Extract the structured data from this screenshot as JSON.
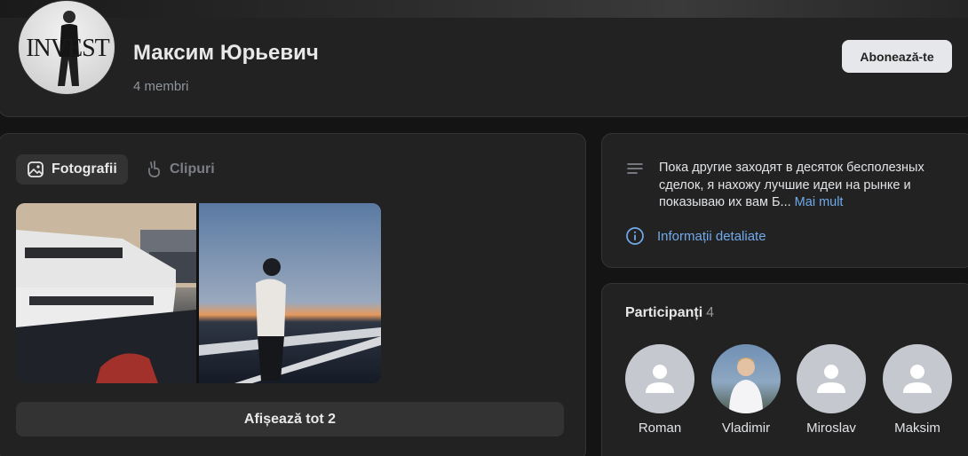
{
  "header": {
    "group_name": "Максим Юрьевич",
    "members": "4 membri",
    "subscribe_label": "Abonează-te",
    "avatar_logo": "INVEST"
  },
  "media": {
    "tabs": [
      {
        "label": "Fotografii",
        "icon": "photo-icon",
        "active": true
      },
      {
        "label": "Clipuri",
        "icon": "clips-icon",
        "active": false
      }
    ],
    "photos": [
      {
        "subject": "yacht"
      },
      {
        "subject": "man-at-sunset"
      }
    ],
    "show_all_label": "Afișează tot 2"
  },
  "info": {
    "description": "Пока другие заходят в десяток бесполезных сделок, я нахожу лучшие идеи на рынке и показываю их вам Б...",
    "more_label": "Mai mult",
    "details_label": "Informații detaliate"
  },
  "participants": {
    "title": "Participanți",
    "count": "4",
    "members": [
      {
        "name": "Roman",
        "has_photo": false
      },
      {
        "name": "Vladimir",
        "has_photo": true
      },
      {
        "name": "Miroslav",
        "has_photo": false
      },
      {
        "name": "Maksim",
        "has_photo": false
      }
    ]
  },
  "colors": {
    "background": "#141414",
    "card": "#222222",
    "accent_link": "#71aaeb",
    "button_light": "#e6e7ea"
  }
}
